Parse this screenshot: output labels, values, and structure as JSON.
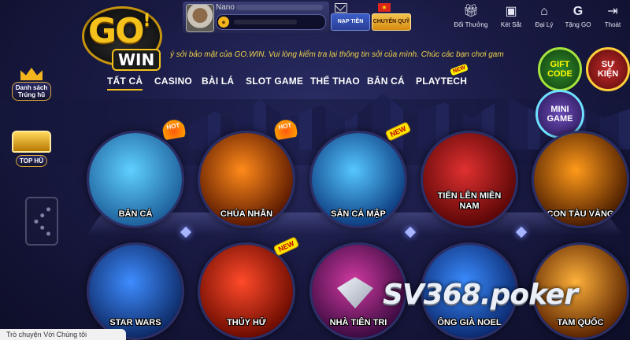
{
  "header": {
    "logo_text_go": "GO",
    "logo_text_exclaim": "!",
    "logo_text_win": "WIN",
    "username": "Nano",
    "deposit_label": "NẠP TIỀN",
    "transfer_label": "CHUYỂN QUỸ",
    "language_flag": "★",
    "tools": [
      {
        "label": "Đổi Thưởng",
        "icon": "gift-icon"
      },
      {
        "label": "Két Sắt",
        "icon": "safe-icon"
      },
      {
        "label": "Đại Lý",
        "icon": "store-icon"
      },
      {
        "label": "Tặng GO",
        "icon": "go-gift-icon"
      },
      {
        "label": "Thoát",
        "icon": "logout-icon"
      }
    ],
    "ticker": "ý sởi bảo mật của GO.WIN. Vui lòng kiểm tra lại thông tin sởi của mình. Chúc các bạn chơi game"
  },
  "nav": {
    "tabs": [
      "TẤT CẢ",
      "CASINO",
      "BÀI LÁ",
      "SLOT GAME",
      "THỂ THAO",
      "BẮN CÁ",
      "PLAYTECH"
    ],
    "new_tag": "NEW"
  },
  "sidebar": {
    "jackpot_list_line1": "Danh sách",
    "jackpot_list_line2": "Trúng hũ",
    "top_hu": "TOP HŨ"
  },
  "side_buttons": {
    "gift_code": [
      "GIFT",
      "CODE"
    ],
    "su_kien": [
      "SỰ",
      "KIỆN"
    ],
    "mini_game": [
      "MINI",
      "GAME"
    ]
  },
  "games_row1": [
    {
      "name": "BẮN CÁ",
      "badge": "HOT",
      "colors": [
        "#5fd0ff",
        "#1d5f9a"
      ]
    },
    {
      "name": "CHÚA NHẪN",
      "badge": "HOT",
      "colors": [
        "#ff8a1a",
        "#5a1800"
      ]
    },
    {
      "name": "SĂN CÁ MẬP",
      "badge": "NEW",
      "colors": [
        "#55c6ff",
        "#0c3c80"
      ]
    },
    {
      "name": "TIẾN LÊN MIỀN NAM",
      "badge": "",
      "colors": [
        "#e03030",
        "#5a0606"
      ]
    },
    {
      "name": "CON TÀU VÀNG",
      "badge": "",
      "colors": [
        "#ff9a1a",
        "#4a1c00"
      ]
    }
  ],
  "games_row2": [
    {
      "name": "STAR WARS",
      "badge": "",
      "colors": [
        "#3e8cff",
        "#0d2a66"
      ]
    },
    {
      "name": "THỦY HỬ",
      "badge": "NEW",
      "colors": [
        "#ff4a2a",
        "#6a0b00"
      ]
    },
    {
      "name": "NHÀ TIÊN TRI",
      "badge": "",
      "colors": [
        "#d03aa0",
        "#3a0a40"
      ]
    },
    {
      "name": "ÔNG GIÀ NOEL",
      "badge": "",
      "colors": [
        "#3a8cff",
        "#0b2a70"
      ]
    },
    {
      "name": "TAM QUỐC",
      "badge": "",
      "colors": [
        "#ffb13a",
        "#5a2300"
      ]
    }
  ],
  "watermark": "SV368.poker",
  "chat": "Trò chuyện Với Chúng tôi"
}
